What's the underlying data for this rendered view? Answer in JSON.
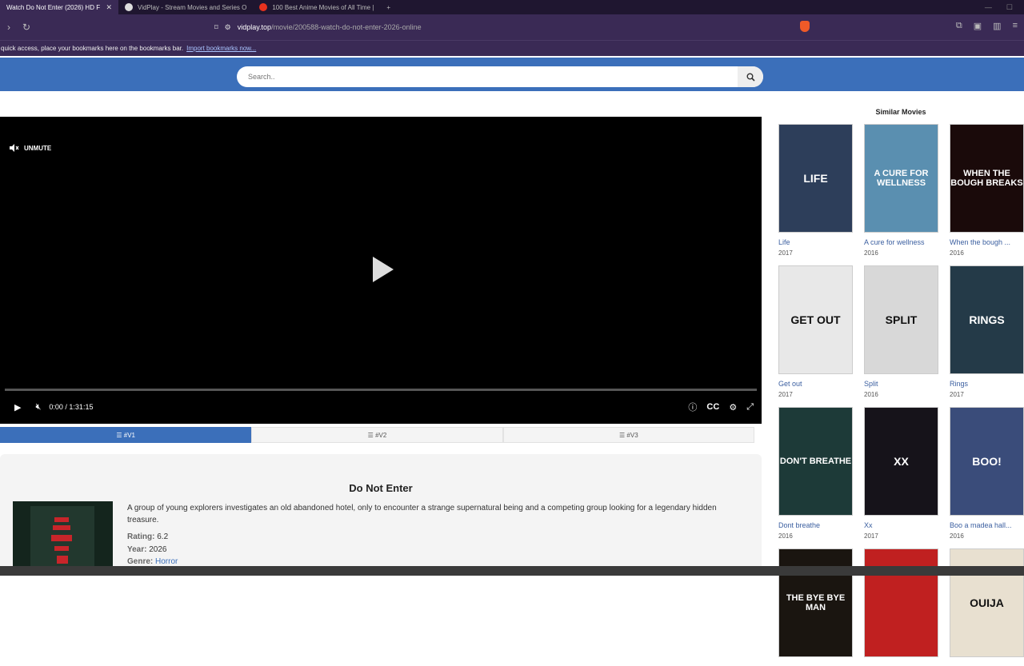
{
  "browser": {
    "tabs": [
      {
        "title": "Watch Do Not Enter (2026) HD F",
        "active": true
      },
      {
        "title": "VidPlay - Stream Movies and Series O",
        "active": false
      },
      {
        "title": "100 Best Anime Movies of All Time |",
        "active": false
      }
    ],
    "url_host": "vidplay.top",
    "url_path": "/movie/200588-watch-do-not-enter-2026-online",
    "bookmarks_text": "quick access, place your bookmarks here on the bookmarks bar.",
    "bookmarks_link": "Import bookmarks now..."
  },
  "search": {
    "placeholder": "Search.."
  },
  "player": {
    "unmute_label": "UNMUTE",
    "time": "0:00 / 1:31:15",
    "cc_label": "CC",
    "progress": 0
  },
  "servers": [
    "#V1",
    "#V2",
    "#V3"
  ],
  "movie": {
    "title": "Do Not Enter",
    "description": "A group of young explorers investigates an old abandoned hotel, only to encounter a strange supernatural being and a competing group looking for a legendary hidden treasure.",
    "rating_label": "Rating:",
    "rating": "6.2",
    "year_label": "Year:",
    "year": "2026",
    "genre_label": "Genre:",
    "genre": "Horror"
  },
  "similar": {
    "heading": "Similar Movies",
    "items": [
      {
        "title": "Life",
        "year": "2017",
        "poster_text": "LIFE",
        "color": "#2d3e5a"
      },
      {
        "title": "A cure for wellness",
        "year": "2016",
        "poster_text": "A CURE FOR WELLNESS",
        "color": "#5a8fb0"
      },
      {
        "title": "When the bough ...",
        "year": "2016",
        "poster_text": "WHEN THE BOUGH BREAKS",
        "color": "#1a0a0a"
      },
      {
        "title": "Get out",
        "year": "2017",
        "poster_text": "GET OUT",
        "color": "#e8e8e8"
      },
      {
        "title": "Split",
        "year": "2016",
        "poster_text": "SPLIT",
        "color": "#d8d8d8"
      },
      {
        "title": "Rings",
        "year": "2017",
        "poster_text": "RINGS",
        "color": "#243a48"
      },
      {
        "title": "Dont breathe",
        "year": "2016",
        "poster_text": "DON'T BREATHE",
        "color": "#1d3a38"
      },
      {
        "title": "Xx",
        "year": "2017",
        "poster_text": "XX",
        "color": "#16131a"
      },
      {
        "title": "Boo a madea hall...",
        "year": "2016",
        "poster_text": "BOO!",
        "color": "#3a4c7a"
      },
      {
        "title": "",
        "year": "",
        "poster_text": "THE BYE BYE MAN",
        "color": "#1a1510"
      },
      {
        "title": "",
        "year": "",
        "poster_text": "",
        "color": "#c02020"
      },
      {
        "title": "",
        "year": "",
        "poster_text": "OUIJA",
        "color": "#e8e0d0"
      }
    ]
  }
}
